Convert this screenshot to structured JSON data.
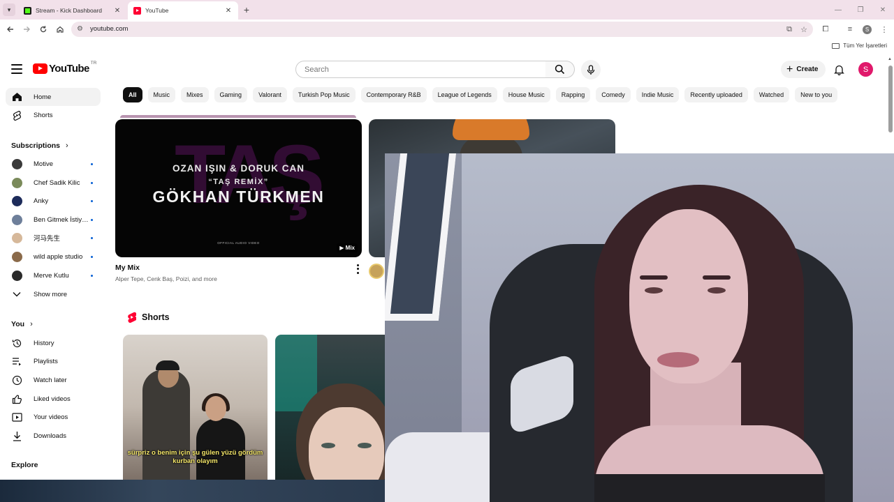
{
  "browser": {
    "tabs": [
      {
        "title": "Stream - Kick Dashboard",
        "active": false
      },
      {
        "title": "YouTube",
        "active": true
      }
    ],
    "address": "youtube.com",
    "bookmarks_all": "Tüm Yer İşaretleri",
    "profile_initial": "S"
  },
  "youtube": {
    "logo_text": "YouTube",
    "country_code": "TR",
    "search_placeholder": "Search",
    "create_label": "Create",
    "avatar_initial": "S",
    "chips": [
      "All",
      "Music",
      "Mixes",
      "Gaming",
      "Valorant",
      "Turkish Pop Music",
      "Contemporary R&B",
      "League of Legends",
      "House Music",
      "Rapping",
      "Comedy",
      "Indie Music",
      "Recently uploaded",
      "Watched",
      "New to you"
    ],
    "active_chip": "All"
  },
  "sidebar": {
    "home": "Home",
    "shorts": "Shorts",
    "subscriptions_title": "Subscriptions",
    "subscriptions": [
      {
        "name": "Motive",
        "color": "#3a3a3a"
      },
      {
        "name": "Chef Sadik Kilic",
        "color": "#7a8a5a"
      },
      {
        "name": "Anky",
        "color": "#1d2b5a"
      },
      {
        "name": "Ben Gitmek İstiyorum",
        "color": "#6e7f9a"
      },
      {
        "name": "河马先生",
        "color": "#d6b89a"
      },
      {
        "name": "wild apple studio",
        "color": "#8a6a4a"
      },
      {
        "name": "Merve Kutlu",
        "color": "#2a2a2a"
      }
    ],
    "show_more": "Show more",
    "you_title": "You",
    "you_items": [
      "History",
      "Playlists",
      "Watch later",
      "Liked videos",
      "Your videos",
      "Downloads"
    ],
    "explore_title": "Explore"
  },
  "feed": {
    "mix": {
      "thumb_line1": "OZAN IŞIN & DORUK CAN",
      "thumb_line2": "“TAŞ REMİX”",
      "thumb_line3": "GÖKHAN TÜRKMEN",
      "thumb_line4": "OFFICIAL AUDIO VIDEO",
      "thumb_bg_text": "TAŞ",
      "badge": "Mix",
      "title": "My Mix",
      "subtitle": "Alper Tepe, Cenk Baş, Poizi, and more"
    },
    "shorts_title": "Shorts",
    "short1_caption": "sürpriz o benim için şu gülen yüzü gördüm kurban olayım"
  }
}
